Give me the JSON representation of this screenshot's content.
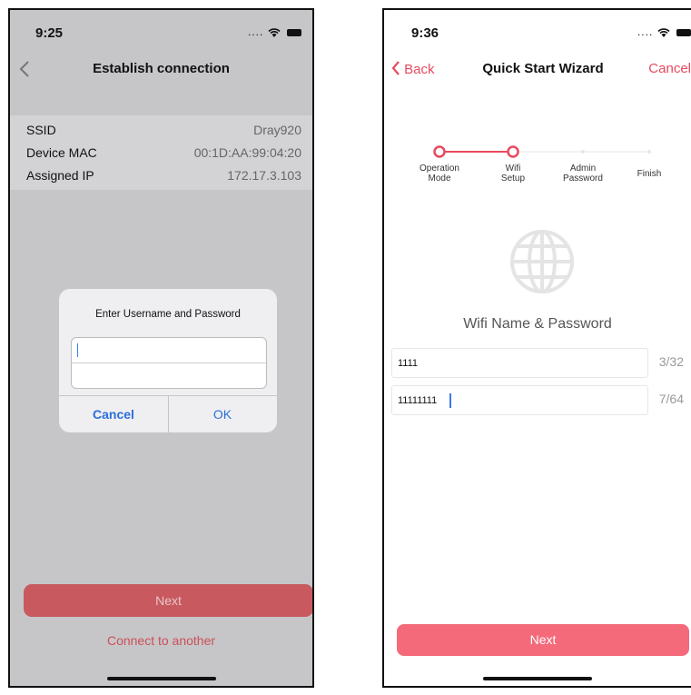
{
  "left": {
    "status": {
      "time": "9:25"
    },
    "nav": {
      "title": "Establish connection"
    },
    "info": [
      {
        "label": "SSID",
        "value": "Dray920"
      },
      {
        "label": "Device MAC",
        "value": "00:1D:AA:99:04:20"
      },
      {
        "label": "Assigned IP",
        "value": "172.17.3.103"
      }
    ],
    "dialog": {
      "title": "Enter Username and Password",
      "username_value": "",
      "password_value": "",
      "cancel_label": "Cancel",
      "ok_label": "OK"
    },
    "next_label": "Next",
    "connect_label": "Connect to another"
  },
  "right": {
    "status": {
      "time": "9:36"
    },
    "nav": {
      "back_label": "Back",
      "title": "Quick Start Wizard",
      "cancel_label": "Cancel"
    },
    "steps": [
      {
        "label_l1": "Operation",
        "label_l2": "Mode"
      },
      {
        "label_l1": "Wifi",
        "label_l2": "Setup"
      },
      {
        "label_l1": "Admin",
        "label_l2": "Password"
      },
      {
        "label_l1": "Finish",
        "label_l2": ""
      }
    ],
    "section_title": "Wifi Name & Password",
    "fields": [
      {
        "value": "1111",
        "count": "3/32"
      },
      {
        "value": "11111111",
        "count": "7/64"
      }
    ],
    "next_label": "Next"
  },
  "colors": {
    "accent": "#e84a5f",
    "link_blue": "#2a6edb"
  },
  "icons": [
    "back-chevron-icon",
    "globe-icon",
    "wifi-icon",
    "battery-icon"
  ]
}
